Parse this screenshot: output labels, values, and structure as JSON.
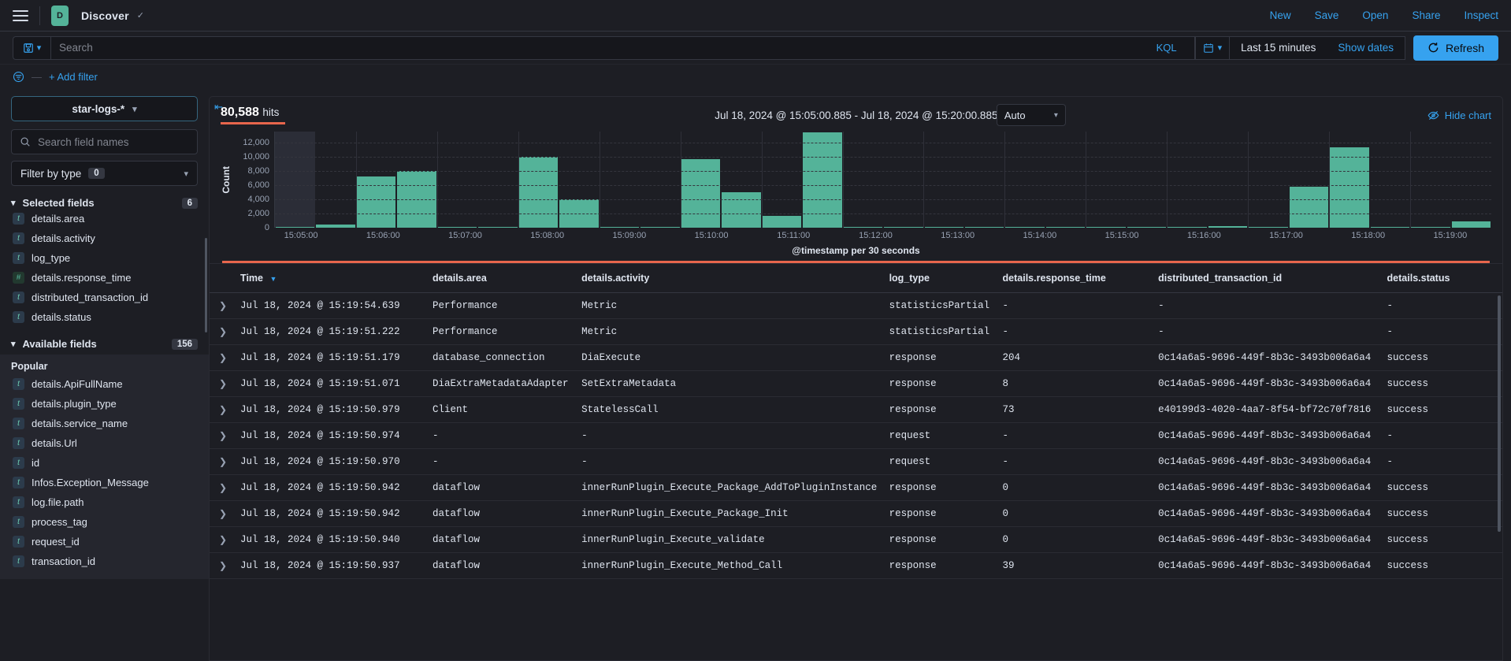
{
  "top_nav": {
    "menu_icon": "hamburger-menu-icon",
    "app_badge": "D",
    "app_title": "Discover",
    "links": [
      "New",
      "Save",
      "Open",
      "Share",
      "Inspect"
    ]
  },
  "query_bar": {
    "saved_query_icon": "save-disk-icon",
    "search_placeholder": "Search",
    "language": "KQL",
    "calendar_icon": "calendar-icon",
    "date_range": "Last 15 minutes",
    "show_dates": "Show dates",
    "refresh": "Refresh"
  },
  "filter_bar": {
    "filter_icon": "filter-list-icon",
    "dash": "—",
    "add_filter": "+ Add filter"
  },
  "sidebar": {
    "index_pattern": "star-logs-*",
    "field_search_placeholder": "Search field names",
    "filter_by_type_label": "Filter by type",
    "filter_by_type_count": "0",
    "selected_fields_label": "Selected fields",
    "selected_fields_count": "6",
    "selected_fields": [
      {
        "name": "details.area",
        "type": "t"
      },
      {
        "name": "details.activity",
        "type": "t"
      },
      {
        "name": "log_type",
        "type": "t"
      },
      {
        "name": "details.response_time",
        "type": "#"
      },
      {
        "name": "distributed_transaction_id",
        "type": "t"
      },
      {
        "name": "details.status",
        "type": "t"
      }
    ],
    "available_fields_label": "Available fields",
    "available_fields_count": "156",
    "popular_label": "Popular",
    "popular_fields": [
      {
        "name": "details.ApiFullName",
        "type": "t"
      },
      {
        "name": "details.plugin_type",
        "type": "t"
      },
      {
        "name": "details.service_name",
        "type": "t"
      },
      {
        "name": "details.Url",
        "type": "t"
      },
      {
        "name": "id",
        "type": "t"
      },
      {
        "name": "Infos.Exception_Message",
        "type": "t"
      },
      {
        "name": "log.file.path",
        "type": "t"
      },
      {
        "name": "process_tag",
        "type": "t"
      },
      {
        "name": "request_id",
        "type": "t"
      },
      {
        "name": "transaction_id",
        "type": "t"
      }
    ]
  },
  "chart_panel": {
    "collapse_icon": "collapse-sidebar-icon",
    "hits_value": "80,588",
    "hits_label": "hits",
    "time_range": "Jul 18, 2024 @ 15:05:00.885 - Jul 18, 2024 @ 15:20:00.885",
    "interval": "Auto",
    "hide_chart_icon": "eye-slash-icon",
    "hide_chart": "Hide chart"
  },
  "chart_data": {
    "type": "bar",
    "title": "",
    "xlabel": "@timestamp per 30 seconds",
    "ylabel": "Count",
    "ylim": [
      0,
      13500
    ],
    "yticks": [
      0,
      2000,
      4000,
      6000,
      8000,
      10000,
      12000
    ],
    "ytick_labels": [
      "0",
      "2,000",
      "4,000",
      "6,000",
      "8,000",
      "10,000",
      "12,000"
    ],
    "xtick_labels": [
      "15:05:00",
      "15:06:00",
      "15:07:00",
      "15:08:00",
      "15:09:00",
      "15:10:00",
      "15:11:00",
      "15:12:00",
      "15:13:00",
      "15:14:00",
      "15:15:00",
      "15:16:00",
      "15:17:00",
      "15:18:00",
      "15:19:00"
    ],
    "grid": true,
    "legend": "none",
    "bar_color": "#54b399",
    "categories": [
      "15:05:00",
      "15:05:30",
      "15:06:00",
      "15:06:30",
      "15:07:00",
      "15:07:30",
      "15:08:00",
      "15:08:30",
      "15:09:00",
      "15:09:30",
      "15:10:00",
      "15:10:30",
      "15:11:00",
      "15:11:30",
      "15:12:00",
      "15:12:30",
      "15:13:00",
      "15:13:30",
      "15:14:00",
      "15:14:30",
      "15:15:00",
      "15:15:30",
      "15:16:00",
      "15:16:30",
      "15:17:00",
      "15:17:30",
      "15:18:00",
      "15:18:30",
      "15:19:00",
      "15:19:30"
    ],
    "values": [
      120,
      400,
      7200,
      8000,
      140,
      140,
      10000,
      4000,
      140,
      140,
      9600,
      5000,
      1700,
      13400,
      120,
      120,
      120,
      120,
      120,
      120,
      120,
      120,
      120,
      250,
      120,
      5800,
      11300,
      120,
      120,
      900
    ]
  },
  "table": {
    "columns": [
      {
        "key": "time",
        "label": "Time",
        "sorted": true
      },
      {
        "key": "area",
        "label": "details.area"
      },
      {
        "key": "activity",
        "label": "details.activity"
      },
      {
        "key": "log_type",
        "label": "log_type"
      },
      {
        "key": "response_time",
        "label": "details.response_time"
      },
      {
        "key": "dtid",
        "label": "distributed_transaction_id"
      },
      {
        "key": "status",
        "label": "details.status"
      }
    ],
    "rows": [
      {
        "time": "Jul 18, 2024 @ 15:19:54.639",
        "area": "Performance",
        "activity": "Metric",
        "log_type": "statisticsPartial",
        "response_time": "-",
        "dtid": "-",
        "status": "-"
      },
      {
        "time": "Jul 18, 2024 @ 15:19:51.222",
        "area": "Performance",
        "activity": "Metric",
        "log_type": "statisticsPartial",
        "response_time": "-",
        "dtid": "-",
        "status": "-"
      },
      {
        "time": "Jul 18, 2024 @ 15:19:51.179",
        "area": "database_connection",
        "activity": "DiaExecute",
        "log_type": "response",
        "response_time": "204",
        "dtid": "0c14a6a5-9696-449f-8b3c-3493b006a6a4",
        "status": "success"
      },
      {
        "time": "Jul 18, 2024 @ 15:19:51.071",
        "area": "DiaExtraMetadataAdapter",
        "activity": "SetExtraMetadata",
        "log_type": "response",
        "response_time": "8",
        "dtid": "0c14a6a5-9696-449f-8b3c-3493b006a6a4",
        "status": "success"
      },
      {
        "time": "Jul 18, 2024 @ 15:19:50.979",
        "area": "Client",
        "activity": "StatelessCall",
        "log_type": "response",
        "response_time": "73",
        "dtid": "e40199d3-4020-4aa7-8f54-bf72c70f7816",
        "status": "success"
      },
      {
        "time": "Jul 18, 2024 @ 15:19:50.974",
        "area": "-",
        "activity": "-",
        "log_type": "request",
        "response_time": "-",
        "dtid": "0c14a6a5-9696-449f-8b3c-3493b006a6a4",
        "status": "-"
      },
      {
        "time": "Jul 18, 2024 @ 15:19:50.970",
        "area": "-",
        "activity": "-",
        "log_type": "request",
        "response_time": "-",
        "dtid": "0c14a6a5-9696-449f-8b3c-3493b006a6a4",
        "status": "-"
      },
      {
        "time": "Jul 18, 2024 @ 15:19:50.942",
        "area": "dataflow",
        "activity": "innerRunPlugin_Execute_Package_AddToPluginInstance",
        "log_type": "response",
        "response_time": "0",
        "dtid": "0c14a6a5-9696-449f-8b3c-3493b006a6a4",
        "status": "success"
      },
      {
        "time": "Jul 18, 2024 @ 15:19:50.942",
        "area": "dataflow",
        "activity": "innerRunPlugin_Execute_Package_Init",
        "log_type": "response",
        "response_time": "0",
        "dtid": "0c14a6a5-9696-449f-8b3c-3493b006a6a4",
        "status": "success"
      },
      {
        "time": "Jul 18, 2024 @ 15:19:50.940",
        "area": "dataflow",
        "activity": "innerRunPlugin_Execute_validate",
        "log_type": "response",
        "response_time": "0",
        "dtid": "0c14a6a5-9696-449f-8b3c-3493b006a6a4",
        "status": "success"
      },
      {
        "time": "Jul 18, 2024 @ 15:19:50.937",
        "area": "dataflow",
        "activity": "innerRunPlugin_Execute_Method_Call",
        "log_type": "response",
        "response_time": "39",
        "dtid": "0c14a6a5-9696-449f-8b3c-3493b006a6a4",
        "status": "success"
      }
    ]
  },
  "colors": {
    "accent_blue": "#36a2ef",
    "accent_green": "#54b399",
    "accent_red": "#e7664c",
    "background": "#1d1e24"
  }
}
